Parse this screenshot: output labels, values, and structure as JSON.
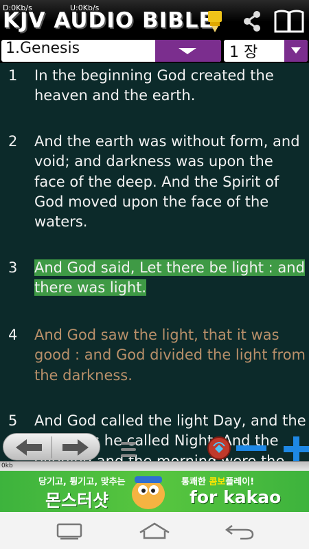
{
  "status": {
    "net_down": "D:0Kb/s",
    "net_up": "U:0Kb/s"
  },
  "header": {
    "title": "KJV AUDIO BIBLE",
    "icons": [
      "pen-icon",
      "share-icon",
      "book-icon"
    ]
  },
  "selectors": {
    "book": "1.Genesis",
    "chapter": "1 장"
  },
  "verses": [
    {
      "num": "1",
      "text": "In the beginning God created the heaven and the earth.",
      "state": "normal"
    },
    {
      "num": "2",
      "text": "And the earth was without form, and void; and darkness was upon the face of the deep. And the Spirit of God moved upon the face of the waters.",
      "state": "normal"
    },
    {
      "num": "3",
      "text": "And God said, Let there be light : and there was light.",
      "state": "highlighted"
    },
    {
      "num": "4",
      "text": "And God saw the light, that it was good :  and God divided the light from the darkness.",
      "state": "read"
    },
    {
      "num": "5",
      "text": "And God called the light Day, and the darkness he called Night. And the evening and the morning were the first day.",
      "state": "normal"
    }
  ],
  "progress": {
    "label": "0kb",
    "value": 0.0
  },
  "ad": {
    "tag_left": "당기고, 튕기고, 맞추는",
    "title_left": "몬스터샷",
    "tag_right_prefix": "통쾌한 ",
    "tag_right_accent": "콤보",
    "tag_right_suffix": "플레이!",
    "title_right": "for kakao"
  },
  "colors": {
    "highlight": "#3f9a45",
    "read_text": "#b9906a",
    "verse_bg": "#0c2a2a",
    "dropdown": "#7b2e8e",
    "ad_bg": "#4cbd3d"
  }
}
